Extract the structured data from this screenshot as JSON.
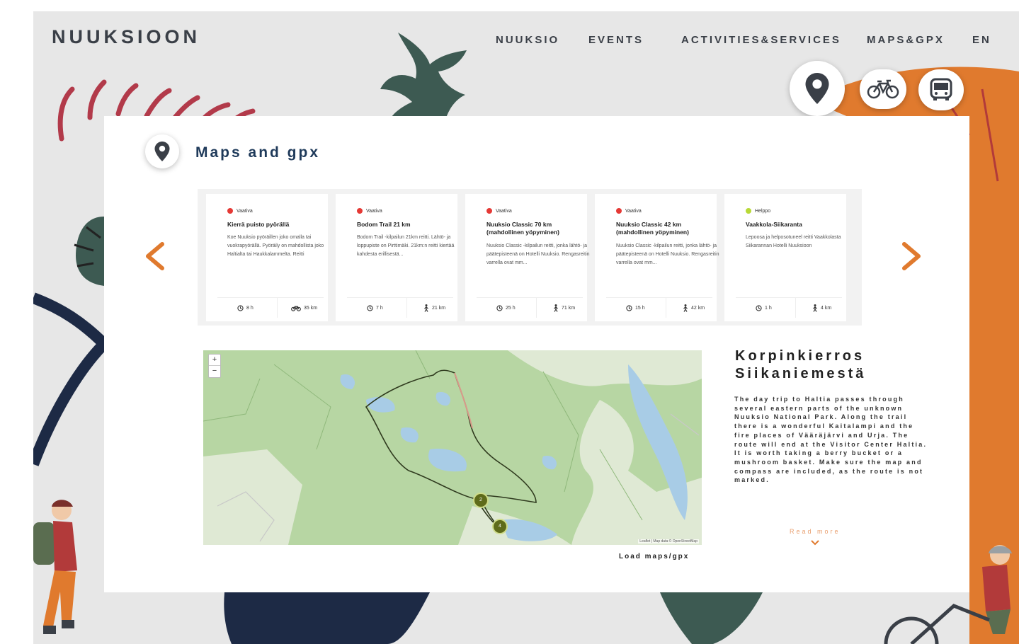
{
  "brand": {
    "logo": "NUUKSIOON"
  },
  "nav": {
    "items": [
      "NUUKSIO",
      "EVENTS",
      "ACTIVITIES&SERVICES",
      "MAPS&GPX",
      "EN"
    ]
  },
  "modes": [
    {
      "icon": "location-pin-icon"
    },
    {
      "icon": "bicycle-icon"
    },
    {
      "icon": "bus-icon"
    }
  ],
  "section": {
    "title": "Maps and gpx",
    "icon": "location-pin-icon"
  },
  "carousel": {
    "prev_icon": "chevron-left-icon",
    "next_icon": "chevron-right-icon",
    "cards": [
      {
        "difficulty": "Vaativa",
        "difficulty_color": "#e53935",
        "title": "Kierrä puisto pyörällä",
        "description": "Koe Nuuksio pyöräillen joko omalla tai vuokrapyörällä. Pyöräily on mahdollista joko Haltialta tai Haukkalammelta. Reitti",
        "time": "8 h",
        "distance": "35 km",
        "mode_icon": "bicycle-icon"
      },
      {
        "difficulty": "Vaativa",
        "difficulty_color": "#e53935",
        "title": "Bodom Trail 21 km",
        "description": "Bodom Trail -kilpailun 21km reitti. Lähtö- ja loppupiste on Pirttimäki. 21km:n reitti kiertää kahdesta erillisestä...",
        "time": "7 h",
        "distance": "21 km",
        "mode_icon": "hiker-icon"
      },
      {
        "difficulty": "Vaativa",
        "difficulty_color": "#e53935",
        "title": "Nuuksio Classic 70 km (mahdollinen yöpyminen)",
        "description": "Nuuksio Classic -kilpailun reitti, jonka lähtö- ja päätepisteenä on Hotelli Nuuksio. Rengasreitin varrella ovat mm...",
        "time": "25 h",
        "distance": "71 km",
        "mode_icon": "hiker-icon"
      },
      {
        "difficulty": "Vaativa",
        "difficulty_color": "#e53935",
        "title": "Nuuksio Classic 42 km (mahdollinen yöpyminen)",
        "description": "Nuuksio Classic -kilpailun reitti, jonka lähtö- ja päätepisteenä on Hotelli Nuuksio. Rengasreitin varrella ovat mm...",
        "time": "15 h",
        "distance": "42 km",
        "mode_icon": "hiker-icon"
      },
      {
        "difficulty": "Helppo",
        "difficulty_color": "#b8d936",
        "title": "Vaakkola-Siikaranta",
        "description": "Lepoosa ja helposotuneel reitti Vaakkolasta Siikarannan Hotelli Nuuksioon",
        "time": "1 h",
        "distance": "4 km",
        "mode_icon": "hiker-icon"
      }
    ]
  },
  "map": {
    "zoom_in": "+",
    "zoom_out": "−",
    "attribution": "Leaflet | Map data © OpenStreetMap",
    "markers": [
      {
        "label": "2"
      },
      {
        "label": "4"
      }
    ]
  },
  "load_link": "Load maps/gpx",
  "route": {
    "title": "Korpinkierros Siikaniemestä",
    "description": "The day trip to Haltia passes through several eastern parts of the unknown Nuuksio National Park. Along the trail there is a wonderful Kaitalampi and the fire places of Vääräjärvi and Urja. The route will end at the Visitor Center Haltia. It is worth taking a berry bucket or a mushroom basket. Make sure the map and compass are included, as the route is not marked.",
    "read_more": "Read more",
    "read_more_icon": "chevron-down-icon"
  },
  "colors": {
    "accent_orange": "#e07a2e",
    "navy": "#1f3a5a",
    "background": "#e7e7e7",
    "map_green": "#b7d6a3"
  }
}
